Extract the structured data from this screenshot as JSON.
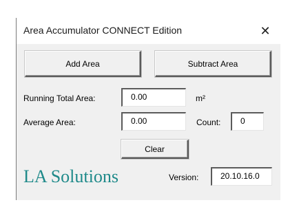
{
  "window": {
    "title": "Area Accumulator CONNECT Edition",
    "close_glyph": "✕"
  },
  "buttons": {
    "add_area": "Add Area",
    "subtract_area": "Subtract Area",
    "clear": "Clear"
  },
  "running_total": {
    "label": "Running Total Area:",
    "value": "0.00",
    "unit": "m²"
  },
  "average": {
    "label": "Average Area:",
    "value": "0.00"
  },
  "count": {
    "label": "Count:",
    "value": "0"
  },
  "brand": {
    "text": "LA Solutions",
    "color": "#1f8a8a"
  },
  "version": {
    "label": "Version:",
    "value": "20.10.16.0"
  }
}
